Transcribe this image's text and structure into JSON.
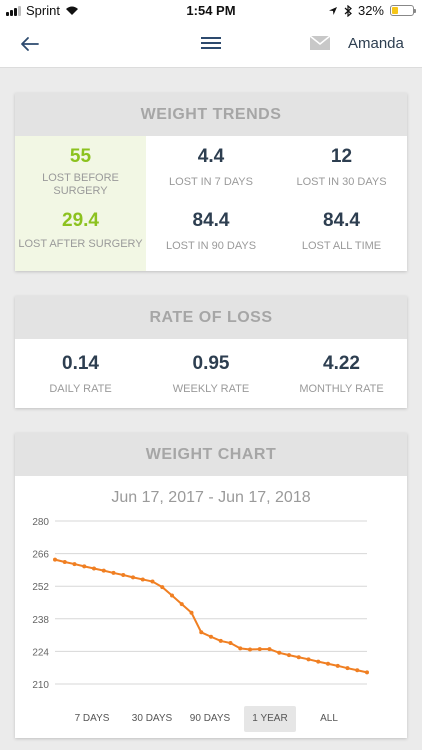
{
  "status_bar": {
    "carrier": "Sprint",
    "time": "1:54 PM",
    "battery": "32%",
    "battery_level": 0.32,
    "signal_bars": 3
  },
  "nav": {
    "user_name": "Amanda"
  },
  "weight_trends": {
    "title": "WEIGHT TRENDS",
    "stats": [
      {
        "value": "55",
        "label": "LOST BEFORE SURGERY"
      },
      {
        "value": "4.4",
        "label": "LOST IN 7 DAYS"
      },
      {
        "value": "12",
        "label": "LOST IN 30 DAYS"
      },
      {
        "value": "29.4",
        "label": "LOST AFTER SURGERY"
      },
      {
        "value": "84.4",
        "label": "LOST IN 90 DAYS"
      },
      {
        "value": "84.4",
        "label": "LOST ALL TIME"
      }
    ]
  },
  "rate_of_loss": {
    "title": "RATE OF LOSS",
    "stats": [
      {
        "value": "0.14",
        "label": "DAILY RATE"
      },
      {
        "value": "0.95",
        "label": "WEEKLY RATE"
      },
      {
        "value": "4.22",
        "label": "MONTHLY RATE"
      }
    ]
  },
  "weight_chart": {
    "title": "WEIGHT CHART",
    "date_range": "Jun 17, 2017 - Jun 17, 2018",
    "ranges": [
      {
        "label": "7 DAYS",
        "active": false
      },
      {
        "label": "30 DAYS",
        "active": false
      },
      {
        "label": "90 DAYS",
        "active": false
      },
      {
        "label": "1 YEAR",
        "active": true
      },
      {
        "label": "ALL",
        "active": false
      }
    ]
  },
  "colors": {
    "accent_green": "#8cc21f",
    "line_orange": "#f07f22",
    "text_dark": "#2d3e50",
    "header_gray": "#e3e3e3"
  },
  "chart_data": {
    "type": "line",
    "title": "",
    "xlabel": "",
    "ylabel": "",
    "ylim": [
      210,
      280
    ],
    "yticks": [
      210,
      224,
      238,
      252,
      266,
      280
    ],
    "grid": true,
    "series": [
      {
        "values": [
          263.4,
          262.4,
          261.5,
          260.5,
          259.6,
          258.7,
          257.7,
          256.8,
          255.8,
          254.9,
          254.0,
          251.6,
          248.0,
          244.3,
          240.6,
          232.2,
          230.3,
          228.5,
          227.6,
          225.3,
          224.8,
          225.0,
          225.0,
          223.4,
          222.4,
          221.5,
          220.6,
          219.6,
          218.7,
          217.8,
          216.8,
          215.9,
          215.0
        ]
      }
    ]
  }
}
